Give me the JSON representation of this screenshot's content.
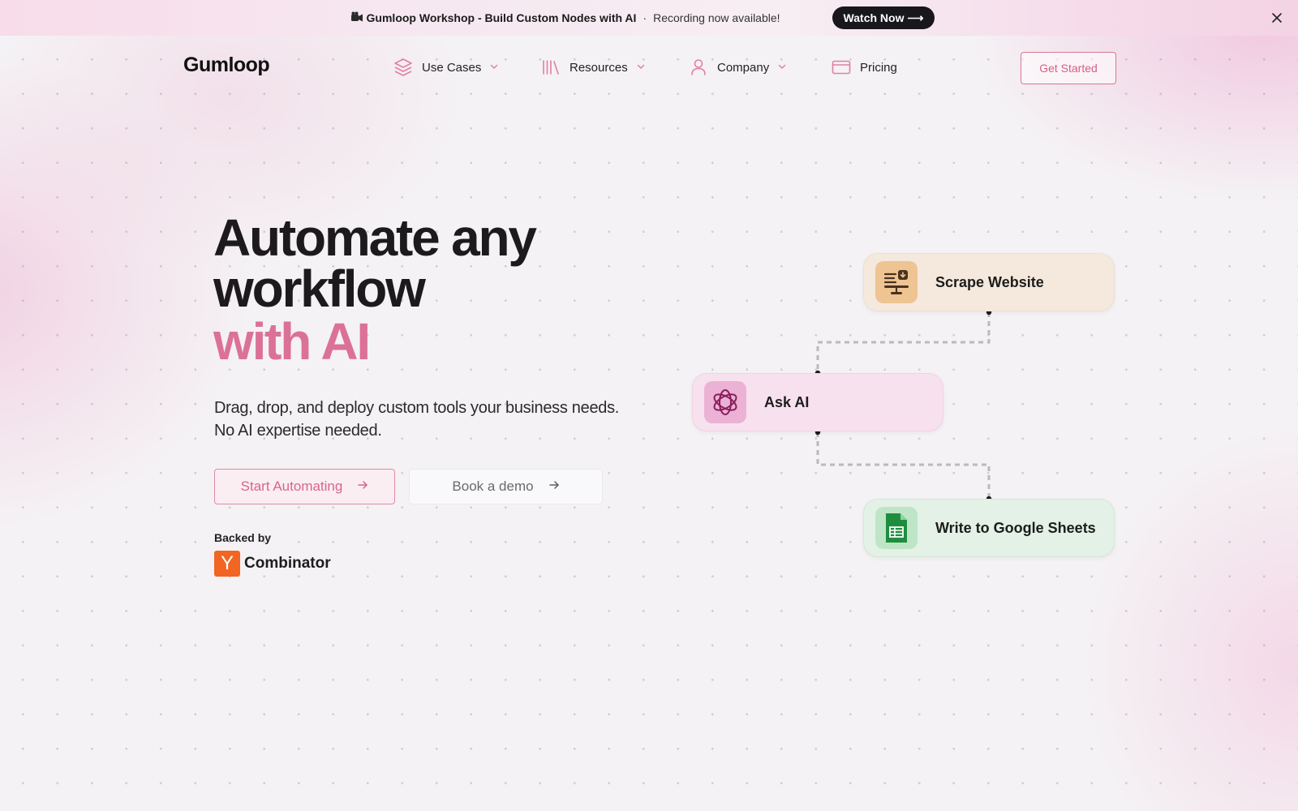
{
  "banner": {
    "title": "Gumloop Workshop - Build Custom Nodes with AI",
    "separator": "·",
    "subtitle": "Recording now available!",
    "cta_label": "Watch Now ⟶",
    "title_icon": "camera-icon",
    "close_icon": "close-icon"
  },
  "nav": {
    "logo": "Gumloop",
    "items": [
      {
        "label": "Use Cases",
        "icon": "layers-icon",
        "has_dropdown": true
      },
      {
        "label": "Resources",
        "icon": "library-icon",
        "has_dropdown": true
      },
      {
        "label": "Company",
        "icon": "user-icon",
        "has_dropdown": true
      },
      {
        "label": "Pricing",
        "icon": "credit-card-icon",
        "has_dropdown": false
      }
    ],
    "cta_label": "Get Started"
  },
  "hero": {
    "title_line1": "Automate any",
    "title_line2": "workflow",
    "title_accent": "with AI",
    "subtitle_line1": "Drag, drop, and deploy custom tools your business needs.",
    "subtitle_line2": "No AI expertise needed.",
    "primary_cta": "Start Automating",
    "secondary_cta": "Book a demo",
    "backed_by": "Backed by",
    "backer_logo_letter": "Y",
    "backer_name": "Combinator"
  },
  "workflow": {
    "nodes": [
      {
        "label": "Scrape Website",
        "icon": "scrape-website-icon"
      },
      {
        "label": "Ask AI",
        "icon": "openai-icon"
      },
      {
        "label": "Write to Google Sheets",
        "icon": "google-sheets-icon"
      }
    ]
  },
  "colors": {
    "accent": "#dc7198",
    "cta_border": "#e08aa5",
    "banner_button": "#17171c",
    "yc_orange": "#f26522"
  }
}
